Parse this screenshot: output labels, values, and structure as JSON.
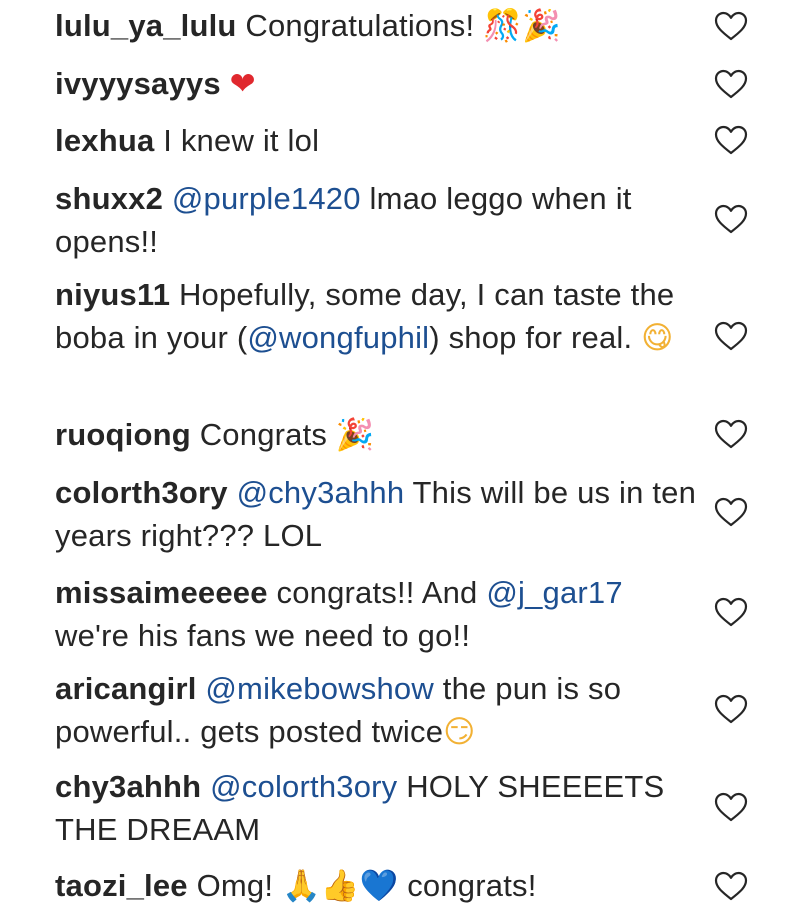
{
  "comments": [
    {
      "username": "lulu_ya_lulu",
      "parts": [
        {
          "type": "text",
          "value": " Congratulations! "
        },
        {
          "type": "emoji",
          "value": "🎊🎉",
          "cls": "party"
        }
      ]
    },
    {
      "username": "ivyyysayys",
      "parts": [
        {
          "type": "text",
          "value": " "
        },
        {
          "type": "emoji",
          "value": "❤",
          "cls": "heart-red"
        }
      ]
    },
    {
      "username": "lexhua",
      "parts": [
        {
          "type": "text",
          "value": " I knew it lol"
        }
      ]
    },
    {
      "username": "shuxx2",
      "parts": [
        {
          "type": "text",
          "value": " "
        },
        {
          "type": "mention",
          "value": "@purple1420"
        },
        {
          "type": "text",
          "value": " lmao leggo when it opens!!"
        }
      ]
    },
    {
      "username": "niyus11",
      "parts": [
        {
          "type": "text",
          "value": " Hopefully, some day, I can taste the boba in your ("
        },
        {
          "type": "mention",
          "value": "@wongfuphil"
        },
        {
          "type": "text",
          "value": ") shop for real. "
        },
        {
          "type": "emoji",
          "value": "😋",
          "cls": "yum"
        }
      ]
    },
    {
      "username": "ruoqiong",
      "parts": [
        {
          "type": "text",
          "value": " Congrats "
        },
        {
          "type": "emoji",
          "value": "🎉",
          "cls": "party"
        }
      ]
    },
    {
      "username": "colorth3ory",
      "parts": [
        {
          "type": "text",
          "value": " "
        },
        {
          "type": "mention",
          "value": "@chy3ahhh"
        },
        {
          "type": "text",
          "value": " This will be us in ten years right??? LOL"
        }
      ]
    },
    {
      "username": "missaimeeeee",
      "parts": [
        {
          "type": "text",
          "value": " congrats!! And "
        },
        {
          "type": "mention",
          "value": "@j_gar17"
        },
        {
          "type": "text",
          "value": " we're his fans we need to go!!"
        }
      ]
    },
    {
      "username": "aricangirl",
      "parts": [
        {
          "type": "text",
          "value": " "
        },
        {
          "type": "mention",
          "value": "@mikebowshow"
        },
        {
          "type": "text",
          "value": " the pun is so powerful.. gets posted twice"
        },
        {
          "type": "emoji",
          "value": "😏",
          "cls": "smirk"
        }
      ]
    },
    {
      "username": "chy3ahhh",
      "parts": [
        {
          "type": "text",
          "value": " "
        },
        {
          "type": "mention",
          "value": "@colorth3ory"
        },
        {
          "type": "text",
          "value": " HOLY SHEEEETS THE DREAAM"
        }
      ]
    },
    {
      "username": "taozi_lee",
      "parts": [
        {
          "type": "text",
          "value": " Omg! "
        },
        {
          "type": "emoji",
          "value": "🙏👍",
          "cls": "pray"
        },
        {
          "type": "emoji",
          "value": "💙",
          "cls": "heart-blue"
        },
        {
          "type": "text",
          "value": " congrats!"
        }
      ]
    }
  ],
  "icons": {
    "like": "heart-outline-icon"
  },
  "colors": {
    "text": "#262626",
    "mention": "#1d4f91",
    "heart_outline": "#262626"
  }
}
